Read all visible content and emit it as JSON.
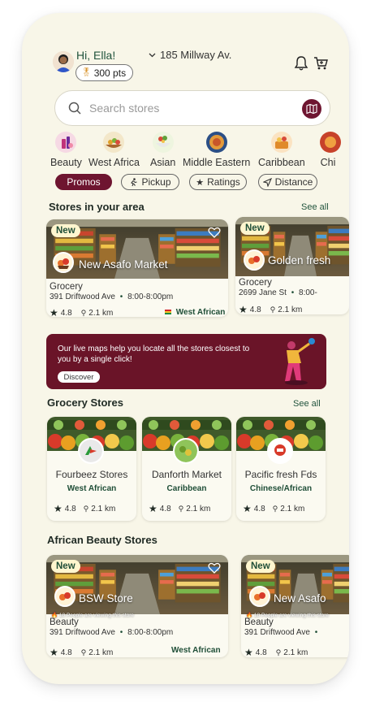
{
  "header": {
    "greeting": "Hi, Ella!",
    "points": "300 pts",
    "address": "185 Millway Av."
  },
  "search": {
    "placeholder": "Search stores"
  },
  "categories": [
    {
      "label": "Beauty"
    },
    {
      "label": "West Africa"
    },
    {
      "label": "Asian"
    },
    {
      "label": "Middle Eastern"
    },
    {
      "label": "Caribbean"
    },
    {
      "label": "Chi"
    }
  ],
  "filters": [
    {
      "label": "Promos",
      "active": true
    },
    {
      "label": "Pickup"
    },
    {
      "label": "Ratings"
    },
    {
      "label": "Distance"
    }
  ],
  "stores_area": {
    "title": "Stores in your area",
    "see_all": "See all",
    "items": [
      {
        "badge": "New",
        "name": "New Asafo Market",
        "category": "Grocery",
        "address": "391 Driftwood Ave",
        "hours": "8:00-8:00pm",
        "rating": "4.8",
        "distance": "2.1 km",
        "tag": "West African"
      },
      {
        "badge": "New",
        "name": "Golden fresh",
        "category": "Grocery",
        "address": "2699 Jane St",
        "hours": "8:00-",
        "rating": "4.8",
        "distance": "2.1 km"
      }
    ]
  },
  "banner": {
    "text": "Our live maps help you locate all the stores closest to you by a single click!",
    "button": "Discover"
  },
  "grocery": {
    "title": "Grocery Stores",
    "see_all": "See all",
    "items": [
      {
        "name": "Fourbeez Stores",
        "tag": "West African",
        "rating": "4.8",
        "distance": "2.1 km"
      },
      {
        "name": "Danforth Market",
        "tag": "Caribbean",
        "rating": "4.8",
        "distance": "2.1 km"
      },
      {
        "name": "Pacific fresh Fds",
        "tag": "Chinese/African",
        "rating": "4.8",
        "distance": "2.1 km"
      }
    ]
  },
  "beauty": {
    "title": "African Beauty Stores",
    "items": [
      {
        "badge": "New",
        "name": "BSW Store",
        "viewers": "18 People are viewing this store",
        "category": "Beauty",
        "address": "391 Driftwood Ave",
        "hours": "8:00-8:00pm",
        "rating": "4.8",
        "distance": "2.1 km",
        "tag": "West African"
      },
      {
        "badge": "New",
        "name": "New Asafo",
        "viewers": "18 People are viewing this store",
        "category": "Beauty",
        "address": "391 Driftwood Ave",
        "hours": "",
        "rating": "4.8",
        "distance": "2.1 km"
      }
    ]
  },
  "colors": {
    "primary": "#6e1530",
    "accent_green": "#22543d",
    "background": "#f8f6e8"
  }
}
